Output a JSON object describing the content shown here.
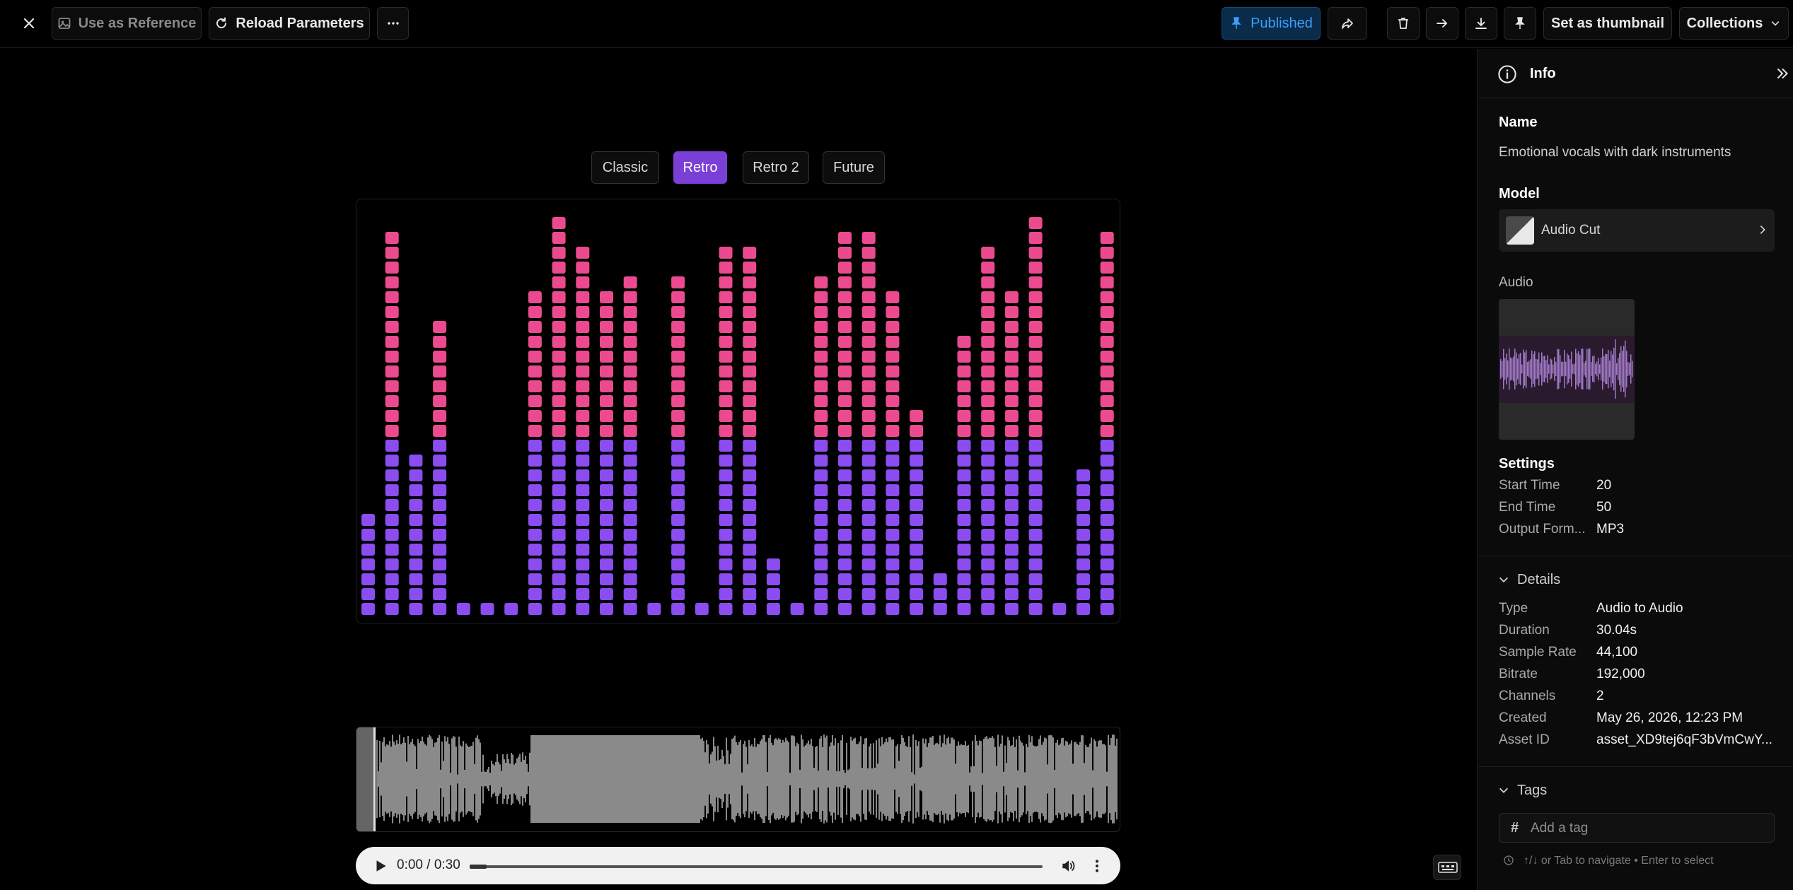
{
  "toolbar": {
    "use_as_reference": "Use as Reference",
    "reload_parameters": "Reload Parameters",
    "published": "Published",
    "set_as_thumbnail": "Set as thumbnail",
    "collections": "Collections"
  },
  "visualizer": {
    "styles": [
      "Classic",
      "Retro",
      "Retro 2",
      "Future"
    ],
    "active_style": "Retro",
    "bar_levels": [
      7,
      26,
      11,
      20,
      1,
      1,
      1,
      22,
      27,
      25,
      22,
      23,
      1,
      23,
      1,
      25,
      25,
      4,
      1,
      23,
      26,
      26,
      22,
      14,
      3,
      19,
      25,
      22,
      27,
      1,
      10,
      26
    ],
    "colors": {
      "low": "#8b4cf0",
      "high": "#ec4a8f",
      "accent": "#7a3fd6"
    }
  },
  "player": {
    "time": "0:00 / 0:30",
    "progress": 0.03
  },
  "panel": {
    "title": "Info",
    "name_label": "Name",
    "name_value": "Emotional vocals with dark instruments",
    "model_label": "Model",
    "model_value": "Audio Cut",
    "audio_label": "Audio",
    "settings_label": "Settings",
    "settings": [
      {
        "key": "Start Time",
        "value": "20"
      },
      {
        "key": "End Time",
        "value": "50"
      },
      {
        "key": "Output Form...",
        "value": "MP3"
      }
    ],
    "details_label": "Details",
    "details": [
      {
        "key": "Type",
        "value": "Audio to Audio"
      },
      {
        "key": "Duration",
        "value": "30.04s"
      },
      {
        "key": "Sample Rate",
        "value": "44,100"
      },
      {
        "key": "Bitrate",
        "value": "192,000"
      },
      {
        "key": "Channels",
        "value": "2"
      },
      {
        "key": "Created",
        "value": "May 26, 2026, 12:23 PM"
      },
      {
        "key": "Asset ID",
        "value": "asset_XD9tej6qF3bVmCwY..."
      }
    ],
    "tags_label": "Tags",
    "tag_placeholder": "Add a tag",
    "hint": "↑/↓ or Tab to navigate • Enter to select"
  }
}
